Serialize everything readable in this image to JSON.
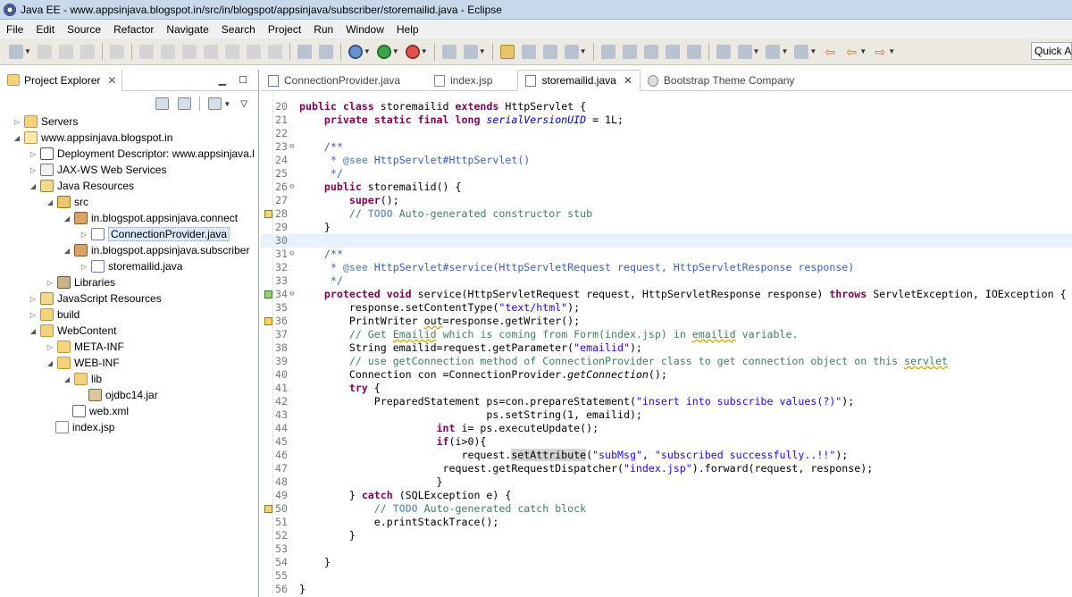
{
  "window": {
    "title": "Java EE - www.appsinjava.blogspot.in/src/in/blogspot/appsinjava/subscriber/storemailid.java - Eclipse"
  },
  "menu": [
    "File",
    "Edit",
    "Source",
    "Refactor",
    "Navigate",
    "Search",
    "Project",
    "Run",
    "Window",
    "Help"
  ],
  "toolbar": {
    "quick_access": "Quick A"
  },
  "explorer": {
    "title": "Project Explorer",
    "close": "✕",
    "tree": [
      {
        "label": "Servers",
        "twisty": "▷",
        "icon": "folder-icon"
      },
      {
        "label": "www.appsinjava.blogspot.in",
        "twisty": "◢",
        "icon": "project-icon"
      },
      {
        "label": "Deployment Descriptor: www.appsinjava.l",
        "twisty": "▷",
        "icon": "descriptor-icon"
      },
      {
        "label": "JAX-WS Web Services",
        "twisty": "▷",
        "icon": "web-services-icon"
      },
      {
        "label": "Java Resources",
        "twisty": "◢",
        "icon": "java-resources-icon"
      },
      {
        "label": "src",
        "twisty": "◢",
        "icon": "source-folder-icon"
      },
      {
        "label": "in.blogspot.appsinjava.connect",
        "twisty": "◢",
        "icon": "package-icon"
      },
      {
        "label": "ConnectionProvider.java",
        "twisty": "▷",
        "icon": "java-file-icon"
      },
      {
        "label": "in.blogspot.appsinjava.subscriber",
        "twisty": "◢",
        "icon": "package-icon"
      },
      {
        "label": "storemailid.java",
        "twisty": "▷",
        "icon": "java-file-icon"
      },
      {
        "label": "Libraries",
        "twisty": "▷",
        "icon": "library-icon"
      },
      {
        "label": "JavaScript Resources",
        "twisty": "▷",
        "icon": "javascript-resources-icon"
      },
      {
        "label": "build",
        "twisty": "▷",
        "icon": "folder-icon"
      },
      {
        "label": "WebContent",
        "twisty": "◢",
        "icon": "folder-icon"
      },
      {
        "label": "META-INF",
        "twisty": "▷",
        "icon": "folder-icon"
      },
      {
        "label": "WEB-INF",
        "twisty": "◢",
        "icon": "folder-icon"
      },
      {
        "label": "lib",
        "twisty": "◢",
        "icon": "folder-icon"
      },
      {
        "label": "ojdbc14.jar",
        "twisty": "",
        "icon": "jar-icon"
      },
      {
        "label": "web.xml",
        "twisty": "",
        "icon": "xml-file-icon"
      },
      {
        "label": "index.jsp",
        "twisty": "",
        "icon": "jsp-file-icon"
      }
    ]
  },
  "editor": {
    "tabs": [
      {
        "label": "ConnectionProvider.java",
        "icon": "java-file-icon"
      },
      {
        "label": "index.jsp",
        "icon": "jsp-file-icon"
      },
      {
        "label": "storemailid.java",
        "icon": "java-file-icon",
        "active": true,
        "close": "✕"
      },
      {
        "label": "Bootstrap Theme Company",
        "icon": "web-page-icon"
      }
    ],
    "lines": [
      {
        "n": "20",
        "html": "<span class=\"kw\">public class</span> storemailid <span class=\"kw\">extends</span> HttpServlet {"
      },
      {
        "n": "21",
        "html": "    <span class=\"kw\">private static final long</span> <span class=\"fld\">serialVersionUID</span> = 1L;"
      },
      {
        "n": "22",
        "html": ""
      },
      {
        "n": "23",
        "fold": "⊖",
        "html": "    <span class=\"jd\">/**</span>"
      },
      {
        "n": "24",
        "html": "<span class=\"jd\">     * </span><span class=\"tag\">@see</span><span class=\"jd\"> HttpServlet#HttpServlet()</span>"
      },
      {
        "n": "25",
        "html": "<span class=\"jd\">     */</span>"
      },
      {
        "n": "26",
        "fold": "⊖",
        "html": "    <span class=\"kw\">public</span> storemailid() {"
      },
      {
        "n": "27",
        "html": "        <span class=\"kw\">super</span>();"
      },
      {
        "n": "28",
        "marker": "task",
        "html": "        <span class=\"cm\">// </span><span class=\"tag\" style=\"color:#7f9fbf\">TODO</span><span class=\"cm\"> Auto-generated constructor stub</span>"
      },
      {
        "n": "29",
        "html": "    }"
      },
      {
        "n": "30",
        "current": true,
        "html": ""
      },
      {
        "n": "31",
        "fold": "⊖",
        "html": "    <span class=\"jd\">/**</span>"
      },
      {
        "n": "32",
        "html": "<span class=\"jd\">     * </span><span class=\"tag\">@see</span><span class=\"jd\"> HttpServlet#service(HttpServletRequest request, HttpServletResponse response)</span>"
      },
      {
        "n": "33",
        "html": "<span class=\"jd\">     */</span>"
      },
      {
        "n": "34",
        "fold": "⊖",
        "marker": "override",
        "html": "    <span class=\"kw\">protected void</span> service(HttpServletRequest request, HttpServletResponse response) <span class=\"kw\">throws</span> ServletException, IOException {"
      },
      {
        "n": "35",
        "html": "        response.setContentType(<span class=\"str\">\"text/html\"</span>);"
      },
      {
        "n": "36",
        "marker": "warning",
        "html": "        PrintWriter <span class=\"sq\">out</span>=response.getWriter();"
      },
      {
        "n": "37",
        "html": "        <span class=\"cm\">// Get <span class=\"sq\">Emailid</span> which is coming from Form(index.jsp) in <span class=\"sq\">emailid</span> variable.</span>"
      },
      {
        "n": "38",
        "html": "        String emailid=request.getParameter(<span class=\"str\">\"emailid\"</span>);"
      },
      {
        "n": "39",
        "html": "        <span class=\"cm\">// use getConnection method of ConnectionProvider class to get connection object on this <span class=\"sq\">servlet</span></span>"
      },
      {
        "n": "40",
        "html": "        Connection con =ConnectionProvider.<span class=\"it\">getConnection</span>();"
      },
      {
        "n": "41",
        "html": "        <span class=\"kw\">try</span> {"
      },
      {
        "n": "42",
        "html": "            PreparedStatement ps=con.prepareStatement(<span class=\"str\">\"insert into subscribe values(?)\"</span>);"
      },
      {
        "n": "43",
        "html": "                              ps.setString(1, emailid);"
      },
      {
        "n": "44",
        "html": "                      <span class=\"kw\">int</span> i= ps.executeUpdate();"
      },
      {
        "n": "45",
        "html": "                      <span class=\"kw\">if</span>(i>0){"
      },
      {
        "n": "46",
        "html": "                          request.<span class=\"hl\">setAttribute</span>(<span class=\"str\">\"subMsg\"</span>, <span class=\"str\">\"subscribed successfully..!!\"</span>);"
      },
      {
        "n": "47",
        "html": "                       request.getRequestDispatcher(<span class=\"str\">\"index.jsp\"</span>).forward(request, response);"
      },
      {
        "n": "48",
        "html": "                      }"
      },
      {
        "n": "49",
        "html": "        } <span class=\"kw\">catch</span> (SQLException e) {"
      },
      {
        "n": "50",
        "marker": "task",
        "html": "            <span class=\"cm\">// </span><span class=\"tag\" style=\"color:#7f9fbf\">TODO</span><span class=\"cm\"> Auto-generated catch block</span>"
      },
      {
        "n": "51",
        "html": "            e.printStackTrace();"
      },
      {
        "n": "52",
        "html": "        }"
      },
      {
        "n": "53",
        "html": ""
      },
      {
        "n": "54",
        "html": "    }"
      },
      {
        "n": "55",
        "html": ""
      },
      {
        "n": "56",
        "html": "}"
      }
    ]
  }
}
